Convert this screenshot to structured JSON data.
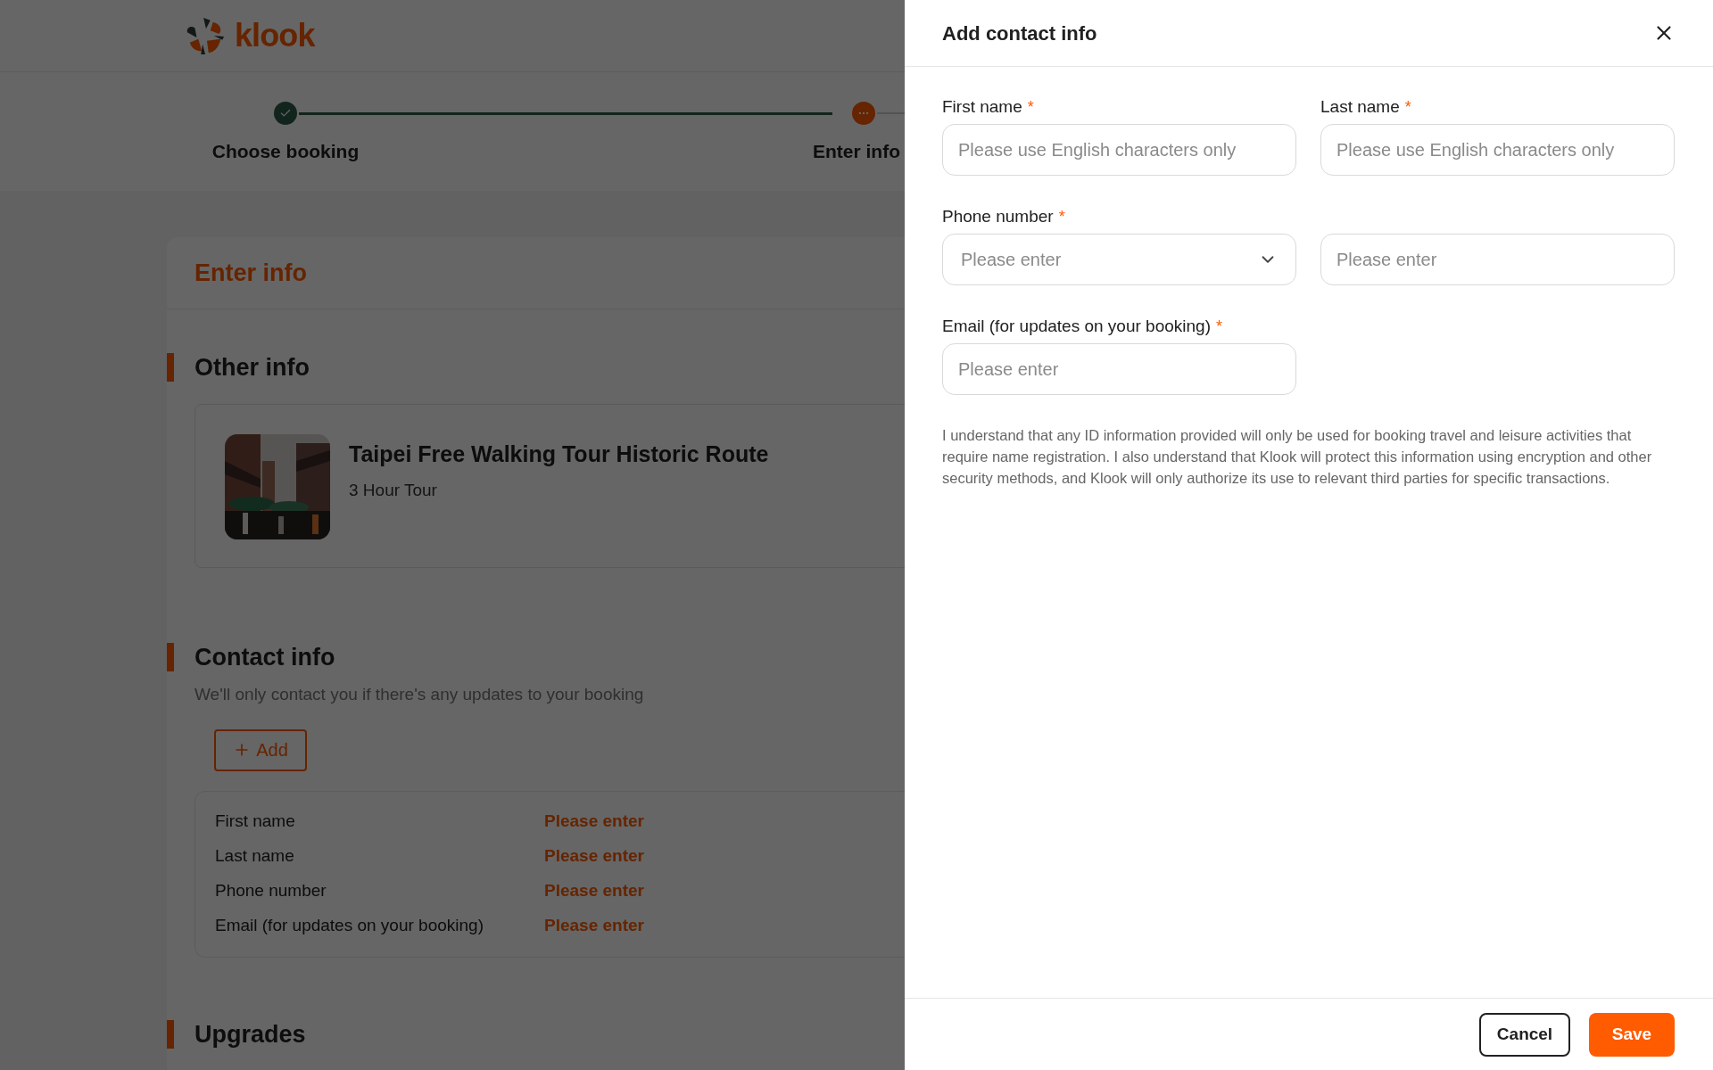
{
  "header": {
    "logo_text": "klook"
  },
  "stepper": [
    {
      "label": "Choose booking",
      "completed": true,
      "selected": false
    },
    {
      "label": "Enter info",
      "completed": false,
      "selected": true
    }
  ],
  "main": {
    "card_title": "Enter info",
    "other_info": {
      "title": "Other info",
      "activity": {
        "title": "Taipei Free Walking Tour Historic Route",
        "subtitle": "3 Hour Tour"
      }
    },
    "contact_info": {
      "title": "Contact info",
      "description": "We'll only contact you if there's any updates to your booking",
      "add_button": "Add",
      "fields": [
        {
          "label": "First name",
          "value": "Please enter"
        },
        {
          "label": "Last name",
          "value": "Please enter"
        },
        {
          "label": "Phone number",
          "value": "Please enter"
        },
        {
          "label": "Email (for updates on your booking)",
          "value": "Please enter"
        }
      ]
    },
    "upgrades": {
      "title": "Upgrades"
    }
  },
  "drawer": {
    "title": "Add contact info",
    "fields": [
      {
        "label": "First name",
        "required_mark": "*",
        "inputs": [
          {
            "kind": "text",
            "placeholder": "Please use English characters only"
          }
        ]
      },
      {
        "label": "Last name",
        "required_mark": "*",
        "inputs": [
          {
            "kind": "text",
            "placeholder": "Please use English characters only"
          }
        ]
      },
      {
        "label": "Phone number",
        "required_mark": "*",
        "inputs": [
          {
            "kind": "select",
            "placeholder": "Please enter"
          },
          {
            "kind": "text",
            "placeholder": "Please enter"
          }
        ]
      },
      {
        "label": "Email (for updates on your booking)",
        "required_mark": "*",
        "inputs": [
          {
            "kind": "text",
            "placeholder": "Please enter"
          }
        ]
      }
    ],
    "notice": "I understand that any ID information provided will only be used for booking travel and leisure activities that require name registration. I also understand that Klook will protect this information using encryption and other security methods, and Klook will only authorize its use to relevant third parties for specific transactions.",
    "cancel_button": "Cancel",
    "save_button": "Save"
  }
}
